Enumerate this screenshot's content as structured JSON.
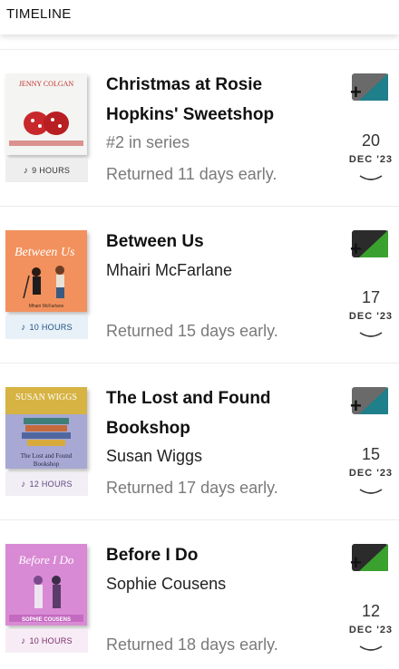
{
  "header": {
    "title": "TIMELINE"
  },
  "items": [
    {
      "title": "Christmas at Rosie Hopkins' Sweetshop",
      "series": "#2 in series",
      "author": "",
      "returned": "Returned 11 days early.",
      "hours": "9 HOURS",
      "day": "20",
      "month": "DEC '23",
      "badge_color": "#1f7f8a",
      "hours_bg": "#eeeeee",
      "hours_color": "#333333",
      "cover_text": "JENNY COLGAN"
    },
    {
      "title": "Between Us",
      "series": "",
      "author": "Mhairi McFarlane",
      "returned": "Returned 15 days early.",
      "hours": "10 HOURS",
      "day": "17",
      "month": "DEC '23",
      "badge_color": "#3aa12f",
      "hours_bg": "#e8f0f8",
      "hours_color": "#1b4f80",
      "cover_text": "Between Us"
    },
    {
      "title": "The Lost and Found Bookshop",
      "series": "",
      "author": "Susan Wiggs",
      "returned": "Returned 17 days early.",
      "hours": "12 HOURS",
      "day": "15",
      "month": "DEC '23",
      "badge_color": "#1f7f8a",
      "hours_bg": "#f1eef5",
      "hours_color": "#5d4780",
      "cover_text": "SUSAN WIGGS"
    },
    {
      "title": "Before I Do",
      "series": "",
      "author": "Sophie Cousens",
      "returned": "Returned 18 days early.",
      "hours": "10 HOURS",
      "day": "12",
      "month": "DEC '23",
      "badge_color": "#3aa12f",
      "hours_bg": "#f7ecf5",
      "hours_color": "#7a2a6c",
      "cover_text": "Before I Do"
    }
  ]
}
